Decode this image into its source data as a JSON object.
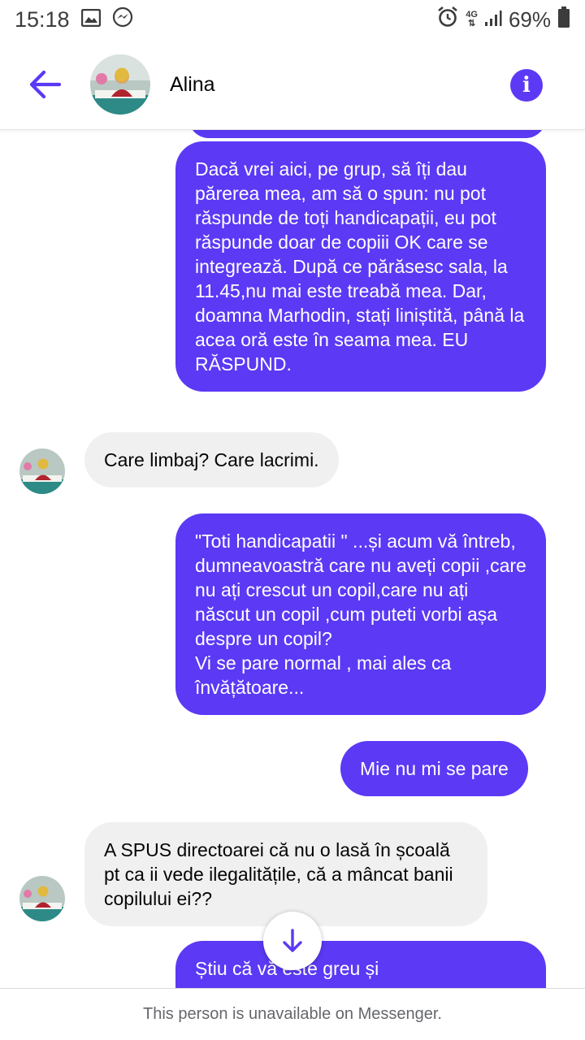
{
  "status_bar": {
    "time": "15:18",
    "network": "4G",
    "battery": "69%",
    "icons": [
      "image-icon",
      "messenger-icon",
      "alarm-icon",
      "signal-icon",
      "battery-icon"
    ]
  },
  "header": {
    "contact_name": "Alina",
    "back_icon": "arrow-left-icon",
    "info_icon": "info-icon",
    "accent_color": "#5b39f5"
  },
  "messages": [
    {
      "direction": "outgoing",
      "text": "Dacă vrei aici, pe grup, să îți dau părerea mea, am să o spun: nu pot răspunde de toți handicapații, eu pot răspunde doar de copiii OK care se integrează. După ce părăsesc sala, la 11.45,nu mai este treabă mea. Dar, doamna Marhodin, stați liniștită, până la acea oră este în seama mea. EU RĂSPUND."
    },
    {
      "direction": "incoming",
      "text": "Care limbaj? Care lacrimi."
    },
    {
      "direction": "outgoing",
      "text": "\"Toti handicapatii \" ...și acum vă întreb, dumneavoastră care nu aveți copii ,care nu ați crescut un copil,care nu ați născut un copil ,cum puteti vorbi așa despre un copil?\nVi se pare normal , mai ales ca învățătoare..."
    },
    {
      "direction": "outgoing",
      "text": "Mie nu mi se pare"
    },
    {
      "direction": "incoming",
      "text": "A SPUS directoarei că nu o lasă în școală pt ca ii vede ilegalitățile, că a mâncat banii copilului ei??"
    },
    {
      "direction": "outgoing",
      "text": "Știu că vă este greu și"
    }
  ],
  "footer": {
    "notice": "This person is unavailable on Messenger."
  }
}
